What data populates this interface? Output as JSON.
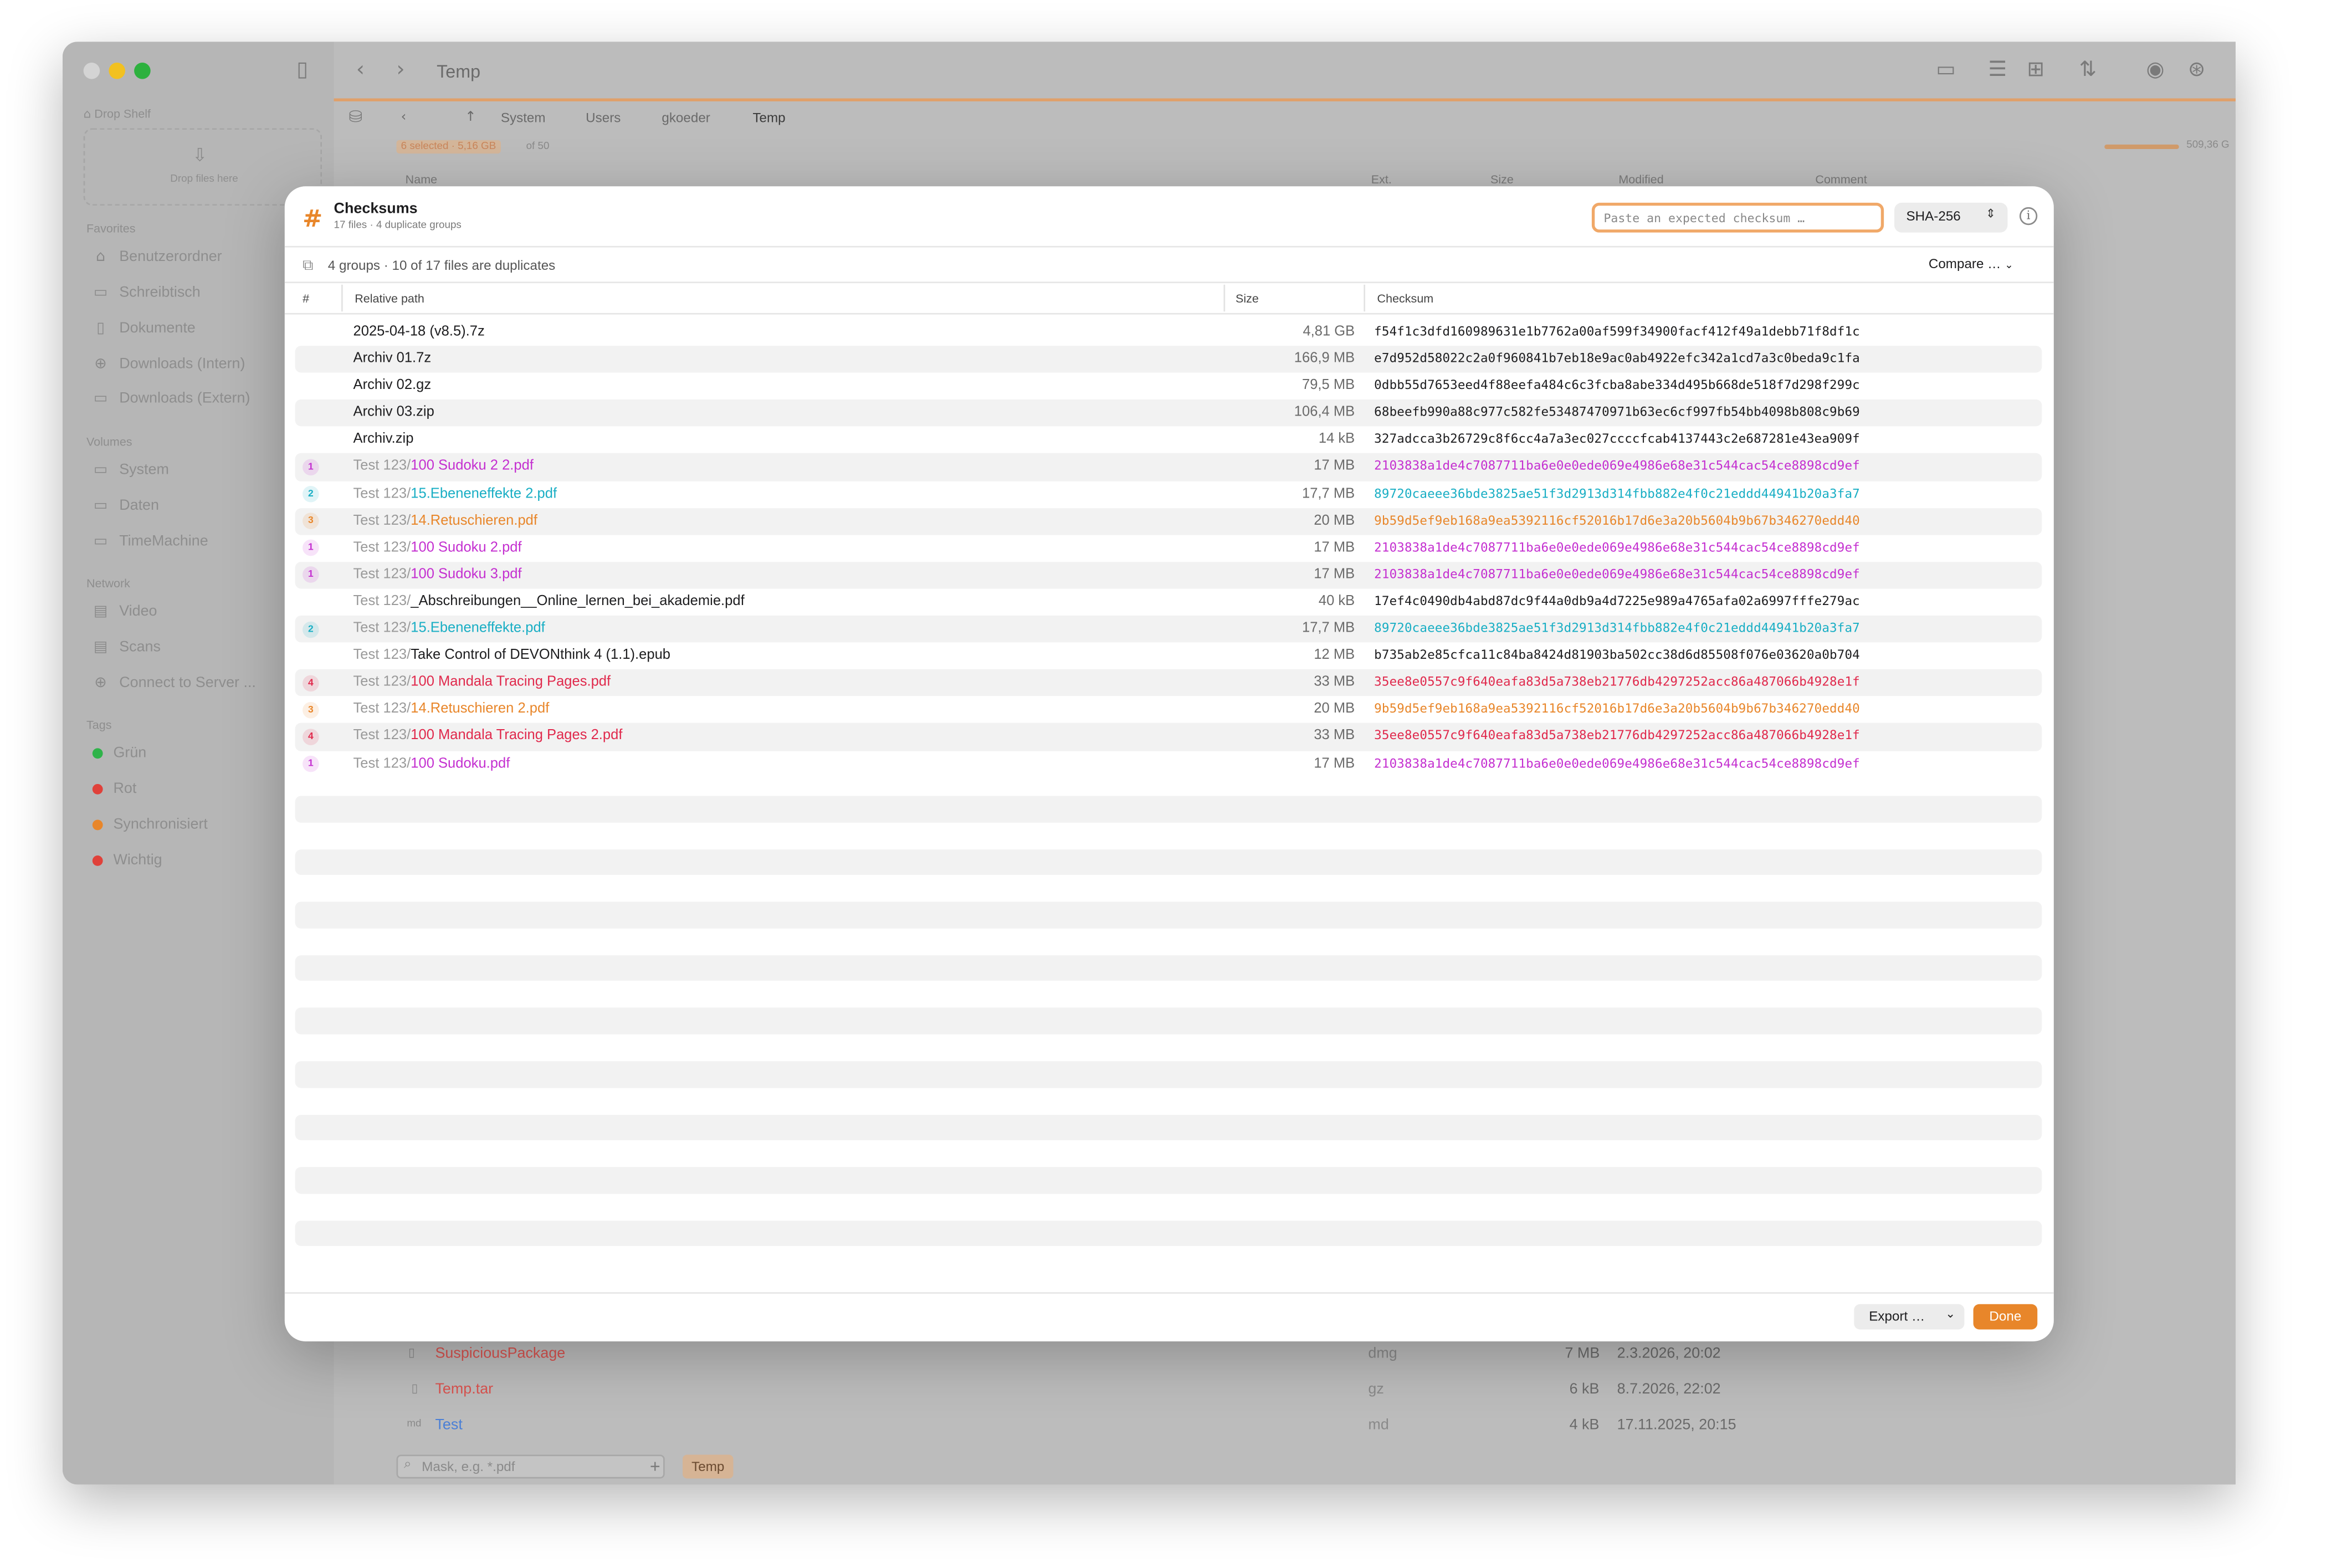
{
  "window": {
    "title": "Temp",
    "breadcrumbs": [
      "System",
      "Users",
      "gkoeder",
      "Temp"
    ],
    "selection_status": "6 selected · 5,16 GB",
    "selection_of": "of 50",
    "disk_free": "509,36 G",
    "columns": [
      "Name",
      "Ext.",
      "Size",
      "Modified",
      "Comment"
    ],
    "filter_placeholder": "Mask, e.g. *.pdf",
    "active_tab": "Temp",
    "bg_rows": [
      {
        "name": "SuspiciousPackage",
        "ext": "dmg",
        "size": "7 MB",
        "modified": "2.3.2026, 20:02",
        "color": "#d9534f"
      },
      {
        "name": "Temp.tar",
        "ext": "gz",
        "size": "6 kB",
        "modified": "8.7.2026, 22:02",
        "color": "#d9534f"
      },
      {
        "name": "Test",
        "ext": "md",
        "size": "4 kB",
        "modified": "17.11.2025, 20:15",
        "color": "#4a7fd6"
      }
    ]
  },
  "sidebar": {
    "drop_shelf": "Drop Shelf",
    "drop_hint": "Drop files here",
    "favorites_title": "Favorites",
    "favorites": [
      "Benutzerordner",
      "Schreibtisch",
      "Dokumente",
      "Downloads (Intern)",
      "Downloads (Extern)"
    ],
    "volumes_title": "Volumes",
    "volumes": [
      "System",
      "Daten",
      "TimeMachine"
    ],
    "network_title": "Network",
    "network": [
      "Video",
      "Scans",
      "Connect to Server ..."
    ],
    "tags_title": "Tags",
    "tags": [
      {
        "label": "Grün",
        "color": "#2fb34a"
      },
      {
        "label": "Rot",
        "color": "#e0413a"
      },
      {
        "label": "Synchronisiert",
        "color": "#e8862a"
      },
      {
        "label": "Wichtig",
        "color": "#e0413a"
      }
    ]
  },
  "dialog": {
    "title": "Checksums",
    "subtitle": "17 files · 4 duplicate groups",
    "expected_placeholder": "Paste an expected checksum …",
    "algorithm": "SHA-256",
    "summary": "4 groups · 10 of 17 files are duplicates",
    "compare_label": "Compare …",
    "col_num": "#",
    "col_path": "Relative path",
    "col_size": "Size",
    "col_checksum": "Checksum",
    "export_label": "Export …",
    "done_label": "Done",
    "group_colors": {
      "1": "#c42fd0",
      "2": "#19aec4",
      "3": "#e8862a",
      "4": "#e0294c"
    },
    "rows": [
      {
        "group": "",
        "dir": "",
        "name": "2025-04-18 (v8.5).7z",
        "size": "4,81 GB",
        "checksum": "f54f1c3dfd160989631e1b7762a00af599f34900facf412f49a1debb71f8df1c"
      },
      {
        "group": "",
        "dir": "",
        "name": "Archiv 01.7z",
        "size": "166,9 MB",
        "checksum": "e7d952d58022c2a0f960841b7eb18e9ac0ab4922efc342a1cd7a3c0beda9c1fa"
      },
      {
        "group": "",
        "dir": "",
        "name": "Archiv 02.gz",
        "size": "79,5 MB",
        "checksum": "0dbb55d7653eed4f88eefa484c6c3fcba8abe334d495b668de518f7d298f299c"
      },
      {
        "group": "",
        "dir": "",
        "name": "Archiv 03.zip",
        "size": "106,4 MB",
        "checksum": "68beefb990a88c977c582fe53487470971b63ec6cf997fb54bb4098b808c9b69"
      },
      {
        "group": "",
        "dir": "",
        "name": "Archiv.zip",
        "size": "14 kB",
        "checksum": "327adcca3b26729c8f6cc4a7a3ec027ccccfcab4137443c2e687281e43ea909f"
      },
      {
        "group": "1",
        "dir": "Test 123/",
        "name": "100 Sudoku 2 2.pdf",
        "size": "17 MB",
        "checksum": "2103838a1de4c7087711ba6e0e0ede069e4986e68e31c544cac54ce8898cd9ef"
      },
      {
        "group": "2",
        "dir": "Test 123/",
        "name": "15.Ebeneneffekte 2.pdf",
        "size": "17,7 MB",
        "checksum": "89720caeee36bde3825ae51f3d2913d314fbb882e4f0c21eddd44941b20a3fa7"
      },
      {
        "group": "3",
        "dir": "Test 123/",
        "name": "14.Retuschieren.pdf",
        "size": "20 MB",
        "checksum": "9b59d5ef9eb168a9ea5392116cf52016b17d6e3a20b5604b9b67b346270edd40"
      },
      {
        "group": "1",
        "dir": "Test 123/",
        "name": "100 Sudoku 2.pdf",
        "size": "17 MB",
        "checksum": "2103838a1de4c7087711ba6e0e0ede069e4986e68e31c544cac54ce8898cd9ef"
      },
      {
        "group": "1",
        "dir": "Test 123/",
        "name": "100 Sudoku 3.pdf",
        "size": "17 MB",
        "checksum": "2103838a1de4c7087711ba6e0e0ede069e4986e68e31c544cac54ce8898cd9ef"
      },
      {
        "group": "",
        "dir": "Test 123/",
        "name": "_Abschreibungen__Online_lernen_bei_akademie.pdf",
        "size": "40 kB",
        "checksum": "17ef4c0490db4abd87dc9f44a0db9a4d7225e989a4765afa02a6997fffe279ac"
      },
      {
        "group": "2",
        "dir": "Test 123/",
        "name": "15.Ebeneneffekte.pdf",
        "size": "17,7 MB",
        "checksum": "89720caeee36bde3825ae51f3d2913d314fbb882e4f0c21eddd44941b20a3fa7"
      },
      {
        "group": "",
        "dir": "Test 123/",
        "name": "Take Control of DEVONthink 4 (1.1).epub",
        "size": "12 MB",
        "checksum": "b735ab2e85cfca11c84ba8424d81903ba502cc38d6d85508f076e03620a0b704"
      },
      {
        "group": "4",
        "dir": "Test 123/",
        "name": "100 Mandala Tracing Pages.pdf",
        "size": "33 MB",
        "checksum": "35ee8e0557c9f640eafa83d5a738eb21776db4297252acc86a487066b4928e1f"
      },
      {
        "group": "3",
        "dir": "Test 123/",
        "name": "14.Retuschieren 2.pdf",
        "size": "20 MB",
        "checksum": "9b59d5ef9eb168a9ea5392116cf52016b17d6e3a20b5604b9b67b346270edd40"
      },
      {
        "group": "4",
        "dir": "Test 123/",
        "name": "100 Mandala Tracing Pages 2.pdf",
        "size": "33 MB",
        "checksum": "35ee8e0557c9f640eafa83d5a738eb21776db4297252acc86a487066b4928e1f"
      },
      {
        "group": "1",
        "dir": "Test 123/",
        "name": "100 Sudoku.pdf",
        "size": "17 MB",
        "checksum": "2103838a1de4c7087711ba6e0e0ede069e4986e68e31c544cac54ce8898cd9ef"
      }
    ]
  }
}
